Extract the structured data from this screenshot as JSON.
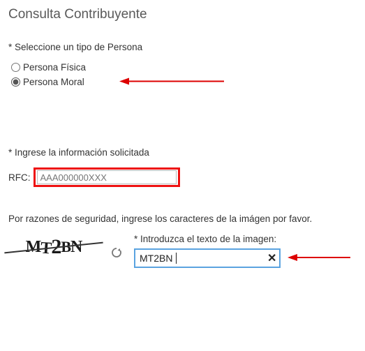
{
  "title": "Consulta Contribuyente",
  "person_type": {
    "label": "* Seleccione un tipo de Persona",
    "options": {
      "fisica": "Persona Física",
      "moral": "Persona Moral"
    },
    "selected": "moral"
  },
  "info_request": {
    "label": "* Ingrese la información solicitada",
    "rfc_label": "RFC:",
    "rfc_value": "",
    "rfc_placeholder": "AAA000000XXX"
  },
  "security_note": "Por razones de seguridad, ingrese los caracteres de la imágen por favor.",
  "captcha": {
    "label": "* Introduzca el texto de la imagen:",
    "image_text": "MT2BN",
    "input_value": "MT2BN",
    "refresh_icon": "refresh-icon",
    "clear_icon": "✕"
  },
  "colors": {
    "highlight": "#e11",
    "focus": "#5aa3e0",
    "arrow": "#d00"
  }
}
